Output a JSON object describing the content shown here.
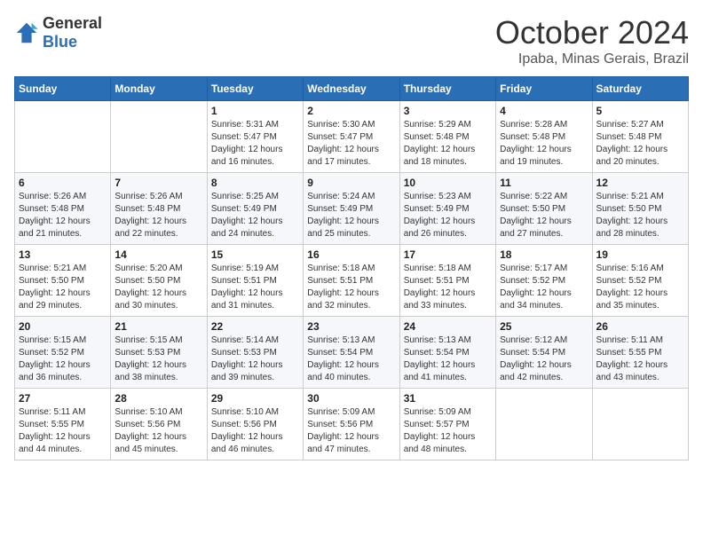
{
  "logo": {
    "general": "General",
    "blue": "Blue"
  },
  "title": {
    "month": "October 2024",
    "location": "Ipaba, Minas Gerais, Brazil"
  },
  "weekdays": [
    "Sunday",
    "Monday",
    "Tuesday",
    "Wednesday",
    "Thursday",
    "Friday",
    "Saturday"
  ],
  "weeks": [
    [
      {
        "day": "",
        "sunrise": "",
        "sunset": "",
        "daylight": ""
      },
      {
        "day": "",
        "sunrise": "",
        "sunset": "",
        "daylight": ""
      },
      {
        "day": "1",
        "sunrise": "Sunrise: 5:31 AM",
        "sunset": "Sunset: 5:47 PM",
        "daylight": "Daylight: 12 hours and 16 minutes."
      },
      {
        "day": "2",
        "sunrise": "Sunrise: 5:30 AM",
        "sunset": "Sunset: 5:47 PM",
        "daylight": "Daylight: 12 hours and 17 minutes."
      },
      {
        "day": "3",
        "sunrise": "Sunrise: 5:29 AM",
        "sunset": "Sunset: 5:48 PM",
        "daylight": "Daylight: 12 hours and 18 minutes."
      },
      {
        "day": "4",
        "sunrise": "Sunrise: 5:28 AM",
        "sunset": "Sunset: 5:48 PM",
        "daylight": "Daylight: 12 hours and 19 minutes."
      },
      {
        "day": "5",
        "sunrise": "Sunrise: 5:27 AM",
        "sunset": "Sunset: 5:48 PM",
        "daylight": "Daylight: 12 hours and 20 minutes."
      }
    ],
    [
      {
        "day": "6",
        "sunrise": "Sunrise: 5:26 AM",
        "sunset": "Sunset: 5:48 PM",
        "daylight": "Daylight: 12 hours and 21 minutes."
      },
      {
        "day": "7",
        "sunrise": "Sunrise: 5:26 AM",
        "sunset": "Sunset: 5:48 PM",
        "daylight": "Daylight: 12 hours and 22 minutes."
      },
      {
        "day": "8",
        "sunrise": "Sunrise: 5:25 AM",
        "sunset": "Sunset: 5:49 PM",
        "daylight": "Daylight: 12 hours and 24 minutes."
      },
      {
        "day": "9",
        "sunrise": "Sunrise: 5:24 AM",
        "sunset": "Sunset: 5:49 PM",
        "daylight": "Daylight: 12 hours and 25 minutes."
      },
      {
        "day": "10",
        "sunrise": "Sunrise: 5:23 AM",
        "sunset": "Sunset: 5:49 PM",
        "daylight": "Daylight: 12 hours and 26 minutes."
      },
      {
        "day": "11",
        "sunrise": "Sunrise: 5:22 AM",
        "sunset": "Sunset: 5:50 PM",
        "daylight": "Daylight: 12 hours and 27 minutes."
      },
      {
        "day": "12",
        "sunrise": "Sunrise: 5:21 AM",
        "sunset": "Sunset: 5:50 PM",
        "daylight": "Daylight: 12 hours and 28 minutes."
      }
    ],
    [
      {
        "day": "13",
        "sunrise": "Sunrise: 5:21 AM",
        "sunset": "Sunset: 5:50 PM",
        "daylight": "Daylight: 12 hours and 29 minutes."
      },
      {
        "day": "14",
        "sunrise": "Sunrise: 5:20 AM",
        "sunset": "Sunset: 5:50 PM",
        "daylight": "Daylight: 12 hours and 30 minutes."
      },
      {
        "day": "15",
        "sunrise": "Sunrise: 5:19 AM",
        "sunset": "Sunset: 5:51 PM",
        "daylight": "Daylight: 12 hours and 31 minutes."
      },
      {
        "day": "16",
        "sunrise": "Sunrise: 5:18 AM",
        "sunset": "Sunset: 5:51 PM",
        "daylight": "Daylight: 12 hours and 32 minutes."
      },
      {
        "day": "17",
        "sunrise": "Sunrise: 5:18 AM",
        "sunset": "Sunset: 5:51 PM",
        "daylight": "Daylight: 12 hours and 33 minutes."
      },
      {
        "day": "18",
        "sunrise": "Sunrise: 5:17 AM",
        "sunset": "Sunset: 5:52 PM",
        "daylight": "Daylight: 12 hours and 34 minutes."
      },
      {
        "day": "19",
        "sunrise": "Sunrise: 5:16 AM",
        "sunset": "Sunset: 5:52 PM",
        "daylight": "Daylight: 12 hours and 35 minutes."
      }
    ],
    [
      {
        "day": "20",
        "sunrise": "Sunrise: 5:15 AM",
        "sunset": "Sunset: 5:52 PM",
        "daylight": "Daylight: 12 hours and 36 minutes."
      },
      {
        "day": "21",
        "sunrise": "Sunrise: 5:15 AM",
        "sunset": "Sunset: 5:53 PM",
        "daylight": "Daylight: 12 hours and 38 minutes."
      },
      {
        "day": "22",
        "sunrise": "Sunrise: 5:14 AM",
        "sunset": "Sunset: 5:53 PM",
        "daylight": "Daylight: 12 hours and 39 minutes."
      },
      {
        "day": "23",
        "sunrise": "Sunrise: 5:13 AM",
        "sunset": "Sunset: 5:54 PM",
        "daylight": "Daylight: 12 hours and 40 minutes."
      },
      {
        "day": "24",
        "sunrise": "Sunrise: 5:13 AM",
        "sunset": "Sunset: 5:54 PM",
        "daylight": "Daylight: 12 hours and 41 minutes."
      },
      {
        "day": "25",
        "sunrise": "Sunrise: 5:12 AM",
        "sunset": "Sunset: 5:54 PM",
        "daylight": "Daylight: 12 hours and 42 minutes."
      },
      {
        "day": "26",
        "sunrise": "Sunrise: 5:11 AM",
        "sunset": "Sunset: 5:55 PM",
        "daylight": "Daylight: 12 hours and 43 minutes."
      }
    ],
    [
      {
        "day": "27",
        "sunrise": "Sunrise: 5:11 AM",
        "sunset": "Sunset: 5:55 PM",
        "daylight": "Daylight: 12 hours and 44 minutes."
      },
      {
        "day": "28",
        "sunrise": "Sunrise: 5:10 AM",
        "sunset": "Sunset: 5:56 PM",
        "daylight": "Daylight: 12 hours and 45 minutes."
      },
      {
        "day": "29",
        "sunrise": "Sunrise: 5:10 AM",
        "sunset": "Sunset: 5:56 PM",
        "daylight": "Daylight: 12 hours and 46 minutes."
      },
      {
        "day": "30",
        "sunrise": "Sunrise: 5:09 AM",
        "sunset": "Sunset: 5:56 PM",
        "daylight": "Daylight: 12 hours and 47 minutes."
      },
      {
        "day": "31",
        "sunrise": "Sunrise: 5:09 AM",
        "sunset": "Sunset: 5:57 PM",
        "daylight": "Daylight: 12 hours and 48 minutes."
      },
      {
        "day": "",
        "sunrise": "",
        "sunset": "",
        "daylight": ""
      },
      {
        "day": "",
        "sunrise": "",
        "sunset": "",
        "daylight": ""
      }
    ]
  ]
}
